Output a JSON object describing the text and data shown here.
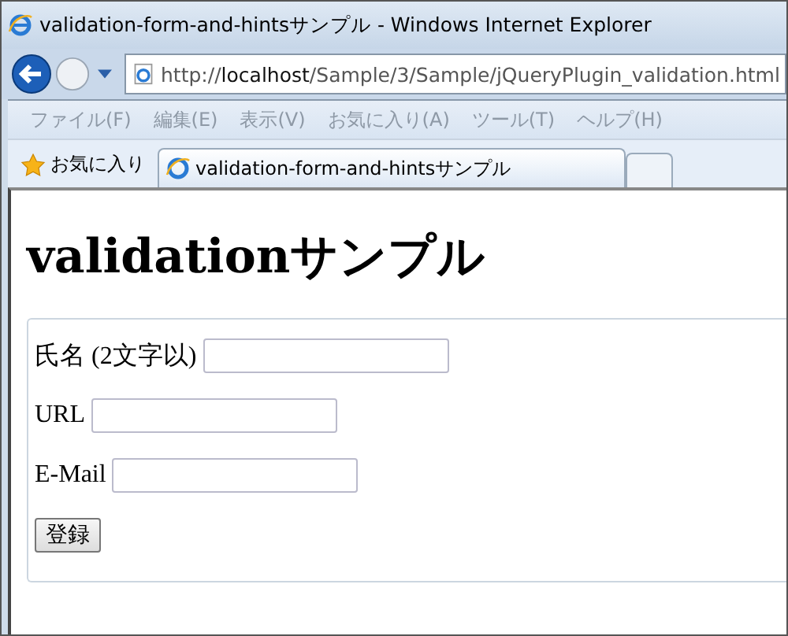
{
  "window": {
    "title": "validation-form-and-hintsサンプル - Windows Internet Explorer"
  },
  "address": {
    "prefix": "http://",
    "host": "localhost",
    "path": "/Sample/3/Sample/jQueryPlugin_validation.html"
  },
  "menu": [
    "ファイル(F)",
    "編集(E)",
    "表示(V)",
    "お気に入り(A)",
    "ツール(T)",
    "ヘルプ(H)"
  ],
  "favorites": {
    "label": "お気に入り"
  },
  "tabs": [
    {
      "label": "validation-form-and-hintsサンプル",
      "selected": true
    }
  ],
  "page": {
    "heading": "validationサンプル",
    "fields": [
      {
        "label": "氏名 (2文字以)"
      },
      {
        "label": "URL"
      },
      {
        "label": "E-Mail"
      }
    ],
    "submit": "登録"
  }
}
